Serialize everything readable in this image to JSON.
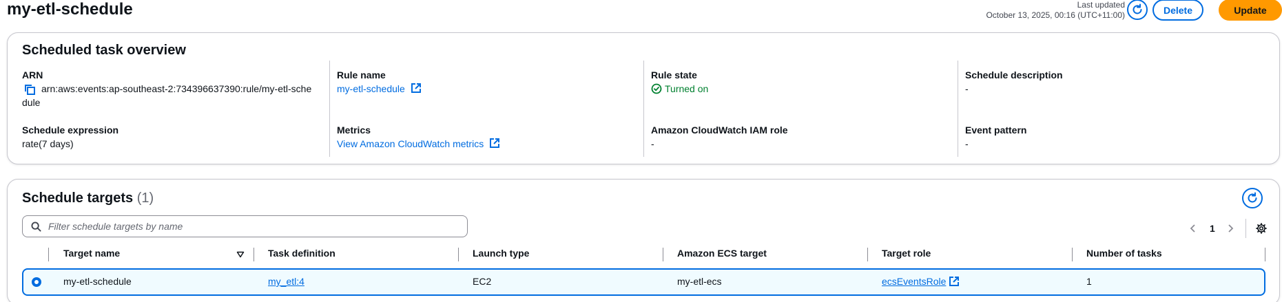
{
  "header": {
    "title": "my-etl-schedule",
    "last_updated_label": "Last updated",
    "last_updated_value": "October 13, 2025, 00:16 (UTC+11:00)",
    "delete_label": "Delete",
    "update_label": "Update"
  },
  "overview": {
    "title": "Scheduled task overview",
    "arn_label": "ARN",
    "arn_line1": "arn:aws:events:ap-southeast-2:734396637390:rule/my-etl-sche",
    "arn_line2": "dule",
    "rule_name_label": "Rule name",
    "rule_name_value": "my-etl-schedule",
    "rule_state_label": "Rule state",
    "rule_state_value": "Turned on",
    "schedule_description_label": "Schedule description",
    "schedule_description_value": "-",
    "schedule_expression_label": "Schedule expression",
    "schedule_expression_value": "rate(7 days)",
    "metrics_label": "Metrics",
    "metrics_value": "View Amazon CloudWatch metrics",
    "iam_role_label": "Amazon CloudWatch IAM role",
    "iam_role_value": "-",
    "event_pattern_label": "Event pattern",
    "event_pattern_value": "-"
  },
  "targets": {
    "title": "Schedule targets",
    "count": "(1)",
    "filter_placeholder": "Filter schedule targets by name",
    "page_number": "1",
    "columns": [
      "Target name",
      "Task definition",
      "Launch type",
      "Amazon ECS target",
      "Target role",
      "Number of tasks"
    ],
    "rows": [
      {
        "target_name": "my-etl-schedule",
        "task_definition": "my_etl:4",
        "launch_type": "EC2",
        "ecs_target": "my-etl-ecs",
        "target_role": "ecsEventsRole",
        "number_of_tasks": "1",
        "selected": true
      }
    ]
  },
  "colors": {
    "accent": "#006ce0",
    "primary_button": "#ff9900",
    "success": "#00802f",
    "selected_row_bg": "#f0fbff"
  },
  "icons": [
    "refresh-icon",
    "copy-icon",
    "external-link-icon",
    "status-success-icon",
    "search-icon",
    "chevron-left-icon",
    "chevron-right-icon",
    "settings-icon",
    "sort-icon",
    "radio-selected-icon"
  ]
}
